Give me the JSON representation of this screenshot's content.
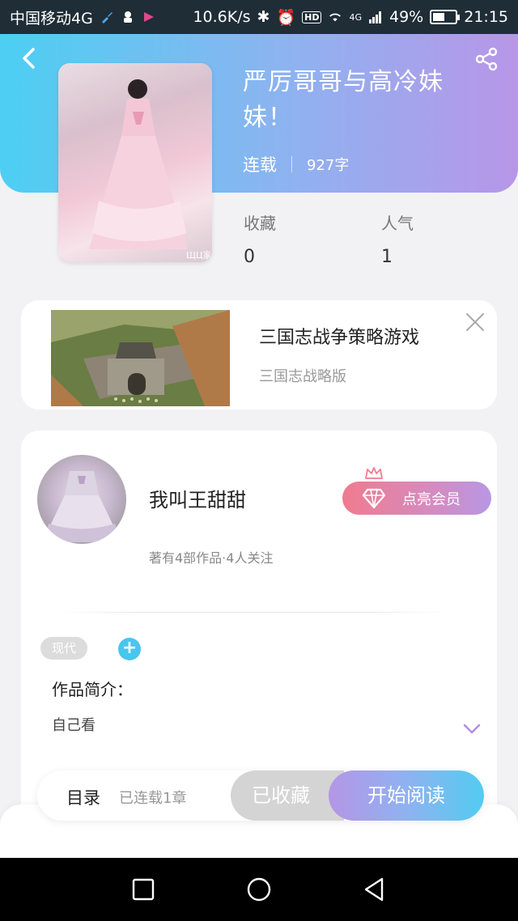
{
  "status_bar": {
    "carrier": "中国移动4G",
    "speed": "10.6K/s",
    "hd": "HD",
    "network": "4G",
    "battery": "49%",
    "time": "21:15"
  },
  "book": {
    "title": "严厉哥哥与高冷妹妹！",
    "status": "连载",
    "word_count": "927字",
    "cover_watermark": "ЩЦ家"
  },
  "stats": {
    "favorites_label": "收藏",
    "favorites_value": "0",
    "popularity_label": "人气",
    "popularity_value": "1"
  },
  "ad": {
    "title": "三国志战争策略游戏",
    "subtitle": "三国志战略版"
  },
  "author": {
    "name": "我叫王甜甜",
    "stats": "著有4部作品·4人关注",
    "vip_label": "点亮会员"
  },
  "tags": [
    "现代"
  ],
  "tag_add": "+",
  "intro": {
    "label": "作品简介：",
    "text": "自己看"
  },
  "action_bar": {
    "toc_label": "目录",
    "toc_count": "已连载1章",
    "collected_label": "已收藏",
    "read_label": "开始阅读"
  },
  "colors": {
    "header_start": "#4ccff3",
    "header_end": "#b896e8",
    "vip_start": "#f07b8e",
    "vip_end": "#b897e4",
    "accent_blue": "#48c6ee"
  },
  "icons": {
    "back": "chevron-left-icon",
    "share": "share-icon",
    "close": "close-icon",
    "vip": "diamond-icon",
    "crown": "crown-icon",
    "expand": "chevron-down-icon"
  }
}
